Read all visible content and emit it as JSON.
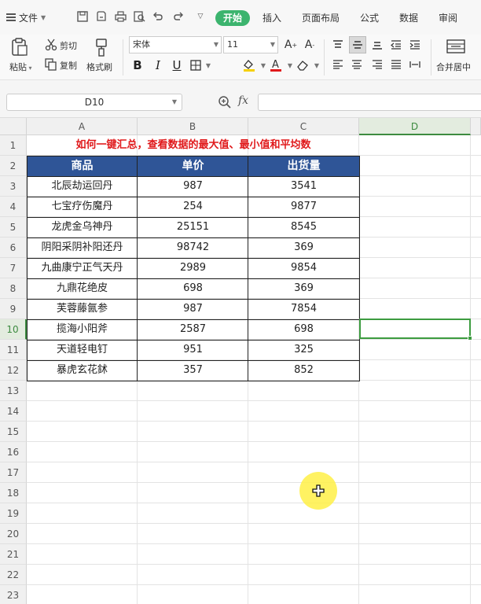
{
  "menubar": {
    "file_label": "文件",
    "tabs": [
      {
        "label": "开始",
        "active": true
      },
      {
        "label": "插入",
        "active": false
      },
      {
        "label": "页面布局",
        "active": false
      },
      {
        "label": "公式",
        "active": false
      },
      {
        "label": "数据",
        "active": false
      },
      {
        "label": "审阅",
        "active": false
      }
    ]
  },
  "ribbon": {
    "paste_label": "粘贴",
    "cut_label": "剪切",
    "copy_label": "复制",
    "format_painter_label": "格式刷",
    "font_name": "宋体",
    "font_size": "11",
    "bold": "B",
    "italic": "I",
    "underline": "U",
    "merge_label": "合并居中"
  },
  "formula_bar": {
    "name_box": "D10",
    "fx_label": "fx",
    "formula_value": ""
  },
  "sheet": {
    "columns": [
      "A",
      "B",
      "C",
      "D"
    ],
    "selected_column": "D",
    "selected_row": "10",
    "row_numbers": [
      "1",
      "2",
      "3",
      "4",
      "5",
      "6",
      "7",
      "8",
      "9",
      "10",
      "11",
      "12",
      "13",
      "14",
      "15",
      "16",
      "17",
      "18",
      "19",
      "20",
      "21",
      "22",
      "23"
    ],
    "title": "如何一键汇总，查看数据的最大值、最小值和平均数",
    "headers": [
      "商品",
      "单价",
      "出货量"
    ],
    "rows": [
      [
        "北辰劫运回丹",
        "987",
        "3541"
      ],
      [
        "七宝疗伤魔丹",
        "254",
        "9877"
      ],
      [
        "龙虎金乌神丹",
        "25151",
        "8545"
      ],
      [
        "阴阳采阴补阳还丹",
        "98742",
        "369"
      ],
      [
        "九曲康宁正气天丹",
        "2989",
        "9854"
      ],
      [
        "九鼎花绝皮",
        "698",
        "369"
      ],
      [
        "芙蓉藤氤参",
        "987",
        "7854"
      ],
      [
        "揽海小阳斧",
        "2587",
        "698"
      ],
      [
        "天道轻电钉",
        "951",
        "325"
      ],
      [
        "暴虎玄花鉥",
        "357",
        "852"
      ]
    ],
    "header_color": "#2f5597",
    "title_color": "#e0191b",
    "selection_color": "#3d9c40"
  }
}
